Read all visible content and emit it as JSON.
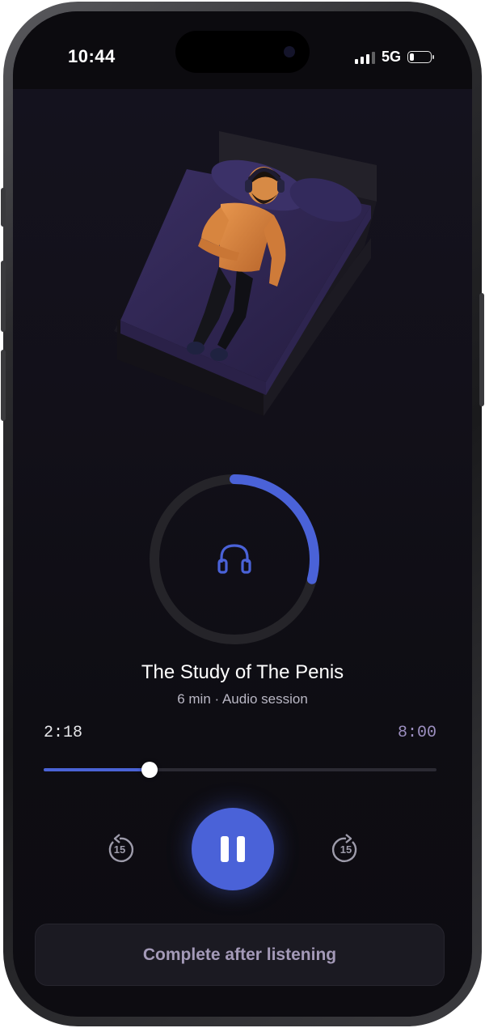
{
  "status_bar": {
    "time": "10:44",
    "network": "5G",
    "signal_bars": 3,
    "battery_level": 0.2
  },
  "session": {
    "illustration": "man-sleeping-on-bed-with-headphones",
    "title": "The Study of The Penis",
    "subtitle": "6 min · Audio session",
    "progress_ring_fraction": 0.29
  },
  "player": {
    "elapsed": "2:18",
    "total": "8:00",
    "progress_fraction": 0.27,
    "skip_back_label": "15",
    "skip_forward_label": "15",
    "state": "playing"
  },
  "actions": {
    "complete_label": "Complete after listening"
  },
  "colors": {
    "accent": "#4a62d8",
    "background": "#0e0d13",
    "muted_text": "#a49ab8"
  }
}
